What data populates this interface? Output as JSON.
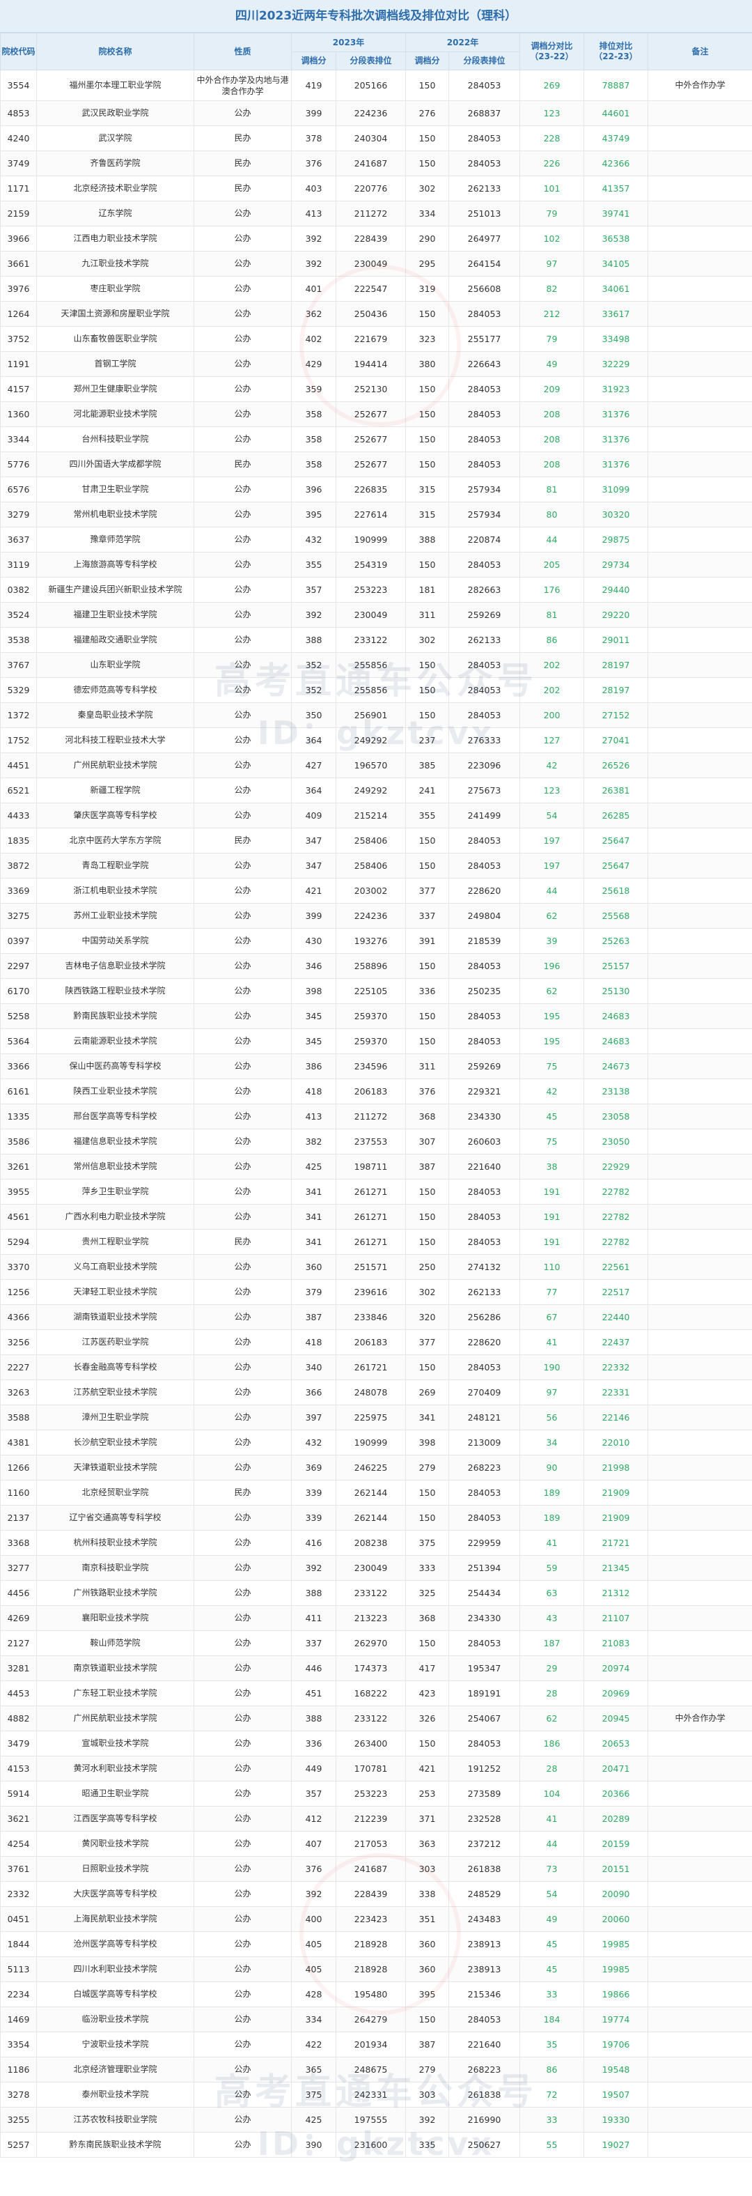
{
  "title": "四川2023近两年专科批次调档线及排位对比（理科）",
  "header": {
    "code": "院校代码",
    "name": "院校名称",
    "nature": "性质",
    "y2023": "2023年",
    "y2022": "2022年",
    "score_cmp": "调档分对比\n（23-22）",
    "rank_cmp": "排位对比\n（22-23）",
    "note": "备注",
    "score": "调档分",
    "rank": "分段表排位"
  },
  "watermark": {
    "line1": "高考直通车公众号",
    "line2": "ID：gkztcvx"
  },
  "colors": {
    "header_bg": "#e4eff8",
    "header_text": "#2e6dab",
    "positive_green": "#2dab62"
  },
  "rows": [
    [
      "3554",
      "福州墨尔本理工职业学院",
      "中外合作办学及内地与港澳合作办学",
      "419",
      "205166",
      "150",
      "284053",
      "269",
      "78887",
      "中外合作办学"
    ],
    [
      "4853",
      "武汉民政职业学院",
      "公办",
      "399",
      "224236",
      "276",
      "268837",
      "123",
      "44601",
      ""
    ],
    [
      "4240",
      "武汉学院",
      "民办",
      "378",
      "240304",
      "150",
      "284053",
      "228",
      "43749",
      ""
    ],
    [
      "3749",
      "齐鲁医药学院",
      "民办",
      "376",
      "241687",
      "150",
      "284053",
      "226",
      "42366",
      ""
    ],
    [
      "1171",
      "北京经济技术职业学院",
      "民办",
      "403",
      "220776",
      "302",
      "262133",
      "101",
      "41357",
      ""
    ],
    [
      "2159",
      "辽东学院",
      "公办",
      "413",
      "211272",
      "334",
      "251013",
      "79",
      "39741",
      ""
    ],
    [
      "3966",
      "江西电力职业技术学院",
      "公办",
      "392",
      "228439",
      "290",
      "264977",
      "102",
      "36538",
      ""
    ],
    [
      "3661",
      "九江职业技术学院",
      "公办",
      "392",
      "230049",
      "295",
      "264154",
      "97",
      "34105",
      ""
    ],
    [
      "3976",
      "枣庄职业学院",
      "公办",
      "401",
      "222547",
      "319",
      "256608",
      "82",
      "34061",
      ""
    ],
    [
      "1264",
      "天津国土资源和房屋职业学院",
      "公办",
      "362",
      "250436",
      "150",
      "284053",
      "212",
      "33617",
      ""
    ],
    [
      "3752",
      "山东畜牧兽医职业学院",
      "公办",
      "402",
      "221679",
      "323",
      "255177",
      "79",
      "33498",
      ""
    ],
    [
      "1191",
      "首钢工学院",
      "公办",
      "429",
      "194414",
      "380",
      "226643",
      "49",
      "32229",
      ""
    ],
    [
      "4157",
      "郑州卫生健康职业学院",
      "公办",
      "359",
      "252130",
      "150",
      "284053",
      "209",
      "31923",
      ""
    ],
    [
      "1360",
      "河北能源职业技术学院",
      "公办",
      "358",
      "252677",
      "150",
      "284053",
      "208",
      "31376",
      ""
    ],
    [
      "3344",
      "台州科技职业学院",
      "公办",
      "358",
      "252677",
      "150",
      "284053",
      "208",
      "31376",
      ""
    ],
    [
      "5776",
      "四川外国语大学成都学院",
      "民办",
      "358",
      "252677",
      "150",
      "284053",
      "208",
      "31376",
      ""
    ],
    [
      "6576",
      "甘肃卫生职业学院",
      "公办",
      "396",
      "226835",
      "315",
      "257934",
      "81",
      "31099",
      ""
    ],
    [
      "3279",
      "常州机电职业技术学院",
      "公办",
      "395",
      "227614",
      "315",
      "257934",
      "80",
      "30320",
      ""
    ],
    [
      "3637",
      "豫章师范学院",
      "公办",
      "432",
      "190999",
      "388",
      "220874",
      "44",
      "29875",
      ""
    ],
    [
      "3119",
      "上海旅游高等专科学校",
      "公办",
      "355",
      "254319",
      "150",
      "284053",
      "205",
      "29734",
      ""
    ],
    [
      "0382",
      "新疆生产建设兵团兴新职业技术学院",
      "公办",
      "357",
      "253223",
      "181",
      "282663",
      "176",
      "29440",
      ""
    ],
    [
      "3524",
      "福建卫生职业技术学院",
      "公办",
      "392",
      "230049",
      "311",
      "259269",
      "81",
      "29220",
      ""
    ],
    [
      "3538",
      "福建船政交通职业学院",
      "公办",
      "388",
      "233122",
      "302",
      "262133",
      "86",
      "29011",
      ""
    ],
    [
      "3767",
      "山东职业学院",
      "公办",
      "352",
      "255856",
      "150",
      "284053",
      "202",
      "28197",
      ""
    ],
    [
      "5329",
      "德宏师范高等专科学校",
      "公办",
      "352",
      "255856",
      "150",
      "284053",
      "202",
      "28197",
      ""
    ],
    [
      "1372",
      "秦皇岛职业技术学院",
      "公办",
      "350",
      "256901",
      "150",
      "284053",
      "200",
      "27152",
      ""
    ],
    [
      "1752",
      "河北科技工程职业技术大学",
      "公办",
      "364",
      "249292",
      "237",
      "276333",
      "127",
      "27041",
      ""
    ],
    [
      "4451",
      "广州民航职业技术学院",
      "公办",
      "427",
      "196570",
      "385",
      "223096",
      "42",
      "26526",
      ""
    ],
    [
      "6521",
      "新疆工程学院",
      "公办",
      "364",
      "249292",
      "241",
      "275673",
      "123",
      "26381",
      ""
    ],
    [
      "4433",
      "肇庆医学高等专科学校",
      "公办",
      "409",
      "215214",
      "355",
      "241499",
      "54",
      "26285",
      ""
    ],
    [
      "1835",
      "北京中医药大学东方学院",
      "民办",
      "347",
      "258406",
      "150",
      "284053",
      "197",
      "25647",
      ""
    ],
    [
      "3872",
      "青岛工程职业学院",
      "公办",
      "347",
      "258406",
      "150",
      "284053",
      "197",
      "25647",
      ""
    ],
    [
      "3369",
      "浙江机电职业技术学院",
      "公办",
      "421",
      "203002",
      "377",
      "228620",
      "44",
      "25618",
      ""
    ],
    [
      "3275",
      "苏州工业职业技术学院",
      "公办",
      "399",
      "224236",
      "337",
      "249804",
      "62",
      "25568",
      ""
    ],
    [
      "0397",
      "中国劳动关系学院",
      "公办",
      "430",
      "193276",
      "391",
      "218539",
      "39",
      "25263",
      ""
    ],
    [
      "2297",
      "吉林电子信息职业技术学院",
      "公办",
      "346",
      "258896",
      "150",
      "284053",
      "196",
      "25157",
      ""
    ],
    [
      "6170",
      "陕西铁路工程职业技术学院",
      "公办",
      "398",
      "225105",
      "336",
      "250235",
      "62",
      "25130",
      ""
    ],
    [
      "5258",
      "黔南民族职业技术学院",
      "公办",
      "345",
      "259370",
      "150",
      "284053",
      "195",
      "24683",
      ""
    ],
    [
      "5364",
      "云南能源职业技术学院",
      "公办",
      "345",
      "259370",
      "150",
      "284053",
      "195",
      "24683",
      ""
    ],
    [
      "3366",
      "保山中医药高等专科学校",
      "公办",
      "386",
      "234596",
      "311",
      "259269",
      "75",
      "24673",
      ""
    ],
    [
      "6161",
      "陕西工业职业技术学院",
      "公办",
      "418",
      "206183",
      "376",
      "229321",
      "42",
      "23138",
      ""
    ],
    [
      "1335",
      "邢台医学高等专科学校",
      "公办",
      "413",
      "211272",
      "368",
      "234330",
      "45",
      "23058",
      ""
    ],
    [
      "3586",
      "福建信息职业技术学院",
      "公办",
      "382",
      "237553",
      "307",
      "260603",
      "75",
      "23050",
      ""
    ],
    [
      "3261",
      "常州信息职业技术学院",
      "公办",
      "425",
      "198711",
      "387",
      "221640",
      "38",
      "22929",
      ""
    ],
    [
      "3955",
      "萍乡卫生职业学院",
      "公办",
      "341",
      "261271",
      "150",
      "284053",
      "191",
      "22782",
      ""
    ],
    [
      "4561",
      "广西水利电力职业技术学院",
      "公办",
      "341",
      "261271",
      "150",
      "284053",
      "191",
      "22782",
      ""
    ],
    [
      "5294",
      "贵州工程职业学院",
      "民办",
      "341",
      "261271",
      "150",
      "284053",
      "191",
      "22782",
      ""
    ],
    [
      "3370",
      "义乌工商职业技术学院",
      "公办",
      "360",
      "251571",
      "250",
      "274132",
      "110",
      "22561",
      ""
    ],
    [
      "1256",
      "天津轻工职业技术学院",
      "公办",
      "379",
      "239616",
      "302",
      "262133",
      "77",
      "22517",
      ""
    ],
    [
      "4366",
      "湖南铁道职业技术学院",
      "公办",
      "387",
      "233846",
      "320",
      "256286",
      "67",
      "22440",
      ""
    ],
    [
      "3256",
      "江苏医药职业学院",
      "公办",
      "418",
      "206183",
      "377",
      "228620",
      "41",
      "22437",
      ""
    ],
    [
      "2227",
      "长春金融高等专科学校",
      "公办",
      "340",
      "261721",
      "150",
      "284053",
      "190",
      "22332",
      ""
    ],
    [
      "3263",
      "江苏航空职业技术学院",
      "公办",
      "366",
      "248078",
      "269",
      "270409",
      "97",
      "22331",
      ""
    ],
    [
      "3588",
      "漳州卫生职业学院",
      "公办",
      "397",
      "225975",
      "341",
      "248121",
      "56",
      "22146",
      ""
    ],
    [
      "4381",
      "长沙航空职业技术学院",
      "公办",
      "432",
      "190999",
      "398",
      "213009",
      "34",
      "22010",
      ""
    ],
    [
      "1266",
      "天津铁道职业技术学院",
      "公办",
      "369",
      "246225",
      "279",
      "268223",
      "90",
      "21998",
      ""
    ],
    [
      "1160",
      "北京经贸职业学院",
      "民办",
      "339",
      "262144",
      "150",
      "284053",
      "189",
      "21909",
      ""
    ],
    [
      "2137",
      "辽宁省交通高等专科学校",
      "公办",
      "339",
      "262144",
      "150",
      "284053",
      "189",
      "21909",
      ""
    ],
    [
      "3368",
      "杭州科技职业技术学院",
      "公办",
      "416",
      "208238",
      "375",
      "229959",
      "41",
      "21721",
      ""
    ],
    [
      "3277",
      "南京科技职业学院",
      "公办",
      "392",
      "230049",
      "333",
      "251394",
      "59",
      "21345",
      ""
    ],
    [
      "4456",
      "广州铁路职业技术学院",
      "公办",
      "388",
      "233122",
      "325",
      "254434",
      "63",
      "21312",
      ""
    ],
    [
      "4269",
      "襄阳职业技术学院",
      "公办",
      "411",
      "213223",
      "368",
      "234330",
      "43",
      "21107",
      ""
    ],
    [
      "2127",
      "鞍山师范学院",
      "公办",
      "337",
      "262970",
      "150",
      "284053",
      "187",
      "21083",
      ""
    ],
    [
      "3281",
      "南京铁道职业技术学院",
      "公办",
      "446",
      "174373",
      "417",
      "195347",
      "29",
      "20974",
      ""
    ],
    [
      "4453",
      "广东轻工职业技术学院",
      "公办",
      "451",
      "168222",
      "423",
      "189191",
      "28",
      "20969",
      ""
    ],
    [
      "4882",
      "广州民航职业技术学院",
      "公办",
      "388",
      "233122",
      "326",
      "254067",
      "62",
      "20945",
      "中外合作办学"
    ],
    [
      "3479",
      "宣城职业技术学院",
      "公办",
      "336",
      "263400",
      "150",
      "284053",
      "186",
      "20653",
      ""
    ],
    [
      "4153",
      "黄河水利职业技术学院",
      "公办",
      "449",
      "170781",
      "421",
      "191252",
      "28",
      "20471",
      ""
    ],
    [
      "5914",
      "昭通卫生职业学院",
      "公办",
      "357",
      "253223",
      "253",
      "273589",
      "104",
      "20366",
      ""
    ],
    [
      "3621",
      "江西医学高等专科学校",
      "公办",
      "412",
      "212239",
      "371",
      "232528",
      "41",
      "20289",
      ""
    ],
    [
      "4254",
      "黄冈职业技术学院",
      "公办",
      "407",
      "217053",
      "363",
      "237212",
      "44",
      "20159",
      ""
    ],
    [
      "3761",
      "日照职业技术学院",
      "公办",
      "376",
      "241687",
      "303",
      "261838",
      "73",
      "20151",
      ""
    ],
    [
      "2332",
      "大庆医学高等专科学校",
      "公办",
      "392",
      "228439",
      "338",
      "248529",
      "54",
      "20090",
      ""
    ],
    [
      "0451",
      "上海民航职业技术学院",
      "公办",
      "400",
      "223423",
      "351",
      "243483",
      "49",
      "20060",
      ""
    ],
    [
      "1844",
      "沧州医学高等专科学校",
      "公办",
      "405",
      "218928",
      "360",
      "238913",
      "45",
      "19985",
      ""
    ],
    [
      "5113",
      "四川水利职业技术学院",
      "公办",
      "405",
      "218928",
      "360",
      "238913",
      "45",
      "19985",
      ""
    ],
    [
      "2234",
      "白城医学高等专科学校",
      "公办",
      "428",
      "195480",
      "395",
      "215346",
      "33",
      "19866",
      ""
    ],
    [
      "1469",
      "临汾职业技术学院",
      "公办",
      "334",
      "264279",
      "150",
      "284053",
      "184",
      "19774",
      ""
    ],
    [
      "3354",
      "宁波职业技术学院",
      "公办",
      "422",
      "201934",
      "387",
      "221640",
      "35",
      "19706",
      ""
    ],
    [
      "1186",
      "北京经济管理职业学院",
      "公办",
      "365",
      "248675",
      "279",
      "268223",
      "86",
      "19548",
      ""
    ],
    [
      "3278",
      "泰州职业技术学院",
      "公办",
      "375",
      "242331",
      "303",
      "261838",
      "72",
      "19507",
      ""
    ],
    [
      "3255",
      "江苏农牧科技职业学院",
      "公办",
      "425",
      "197555",
      "392",
      "216990",
      "33",
      "19330",
      ""
    ],
    [
      "5257",
      "黔东南民族职业技术学院",
      "公办",
      "390",
      "231600",
      "335",
      "250627",
      "55",
      "19027",
      ""
    ]
  ]
}
